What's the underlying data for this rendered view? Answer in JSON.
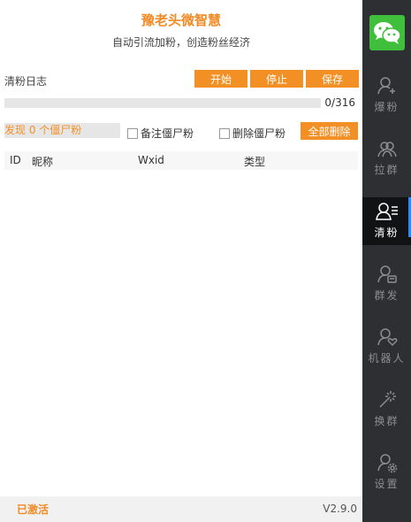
{
  "header": {
    "title": "豫老头微智慧",
    "subtitle": "自动引流加粉，创造粉丝经济"
  },
  "log": {
    "label": "清粉日志",
    "start_label": "开始",
    "stop_label": "停止",
    "save_label": "保存"
  },
  "progress": {
    "text": "0/316",
    "done": 0,
    "total": 316
  },
  "controls": {
    "found_text": "发现 0 个僵尸粉",
    "remark_label": "备注僵尸粉",
    "delete_label": "删除僵尸粉",
    "delete_all_label": "全部删除"
  },
  "table": {
    "columns": [
      "ID",
      "昵称",
      "Wxid",
      "类型"
    ],
    "rows": []
  },
  "footer": {
    "status": "已激活",
    "version": "V2.9.0"
  },
  "sidebar": {
    "logo_icon": "wechat-logo-icon",
    "active_index": 2,
    "items": [
      {
        "label": "爆粉",
        "icon": "user-add-icon"
      },
      {
        "label": "拉群",
        "icon": "group-icon"
      },
      {
        "label": "清粉",
        "icon": "user-list-icon"
      },
      {
        "label": "群发",
        "icon": "user-message-icon"
      },
      {
        "label": "机器人",
        "icon": "user-heart-icon"
      },
      {
        "label": "换群",
        "icon": "magic-wand-icon"
      },
      {
        "label": "设置",
        "icon": "user-settings-icon"
      }
    ]
  },
  "colors": {
    "accent": "#f39025",
    "sidebar_bg": "#2d2f33",
    "active_indicator": "#2f8af5",
    "logo_green": "#3fbf3c"
  }
}
